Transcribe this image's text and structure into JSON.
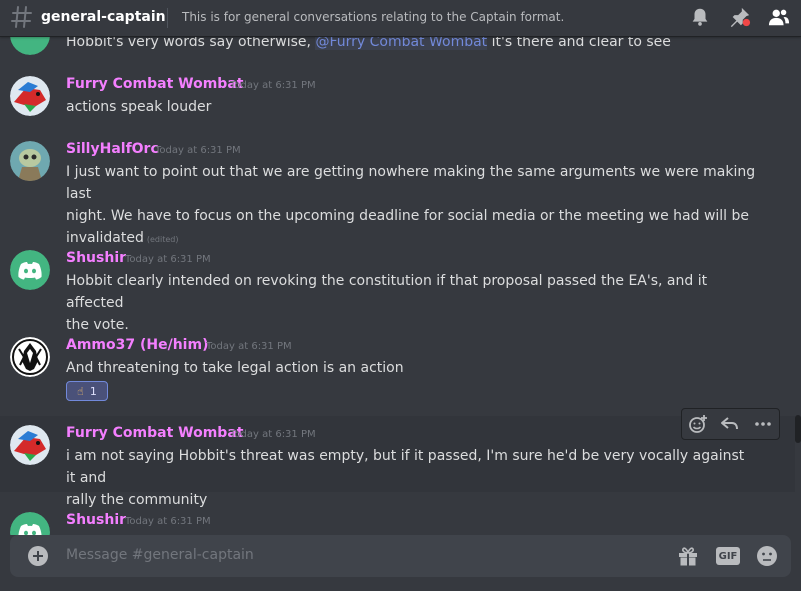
{
  "header": {
    "channel_name": "general-captain",
    "topic": "This is for general conversations relating to the Captain format."
  },
  "messages": [
    {
      "id": "m0",
      "text_before": "Hobbit's very words say otherwise, ",
      "mention": "@Furry Combat Wombat",
      "text_after": " it's there and clear to see"
    },
    {
      "id": "m1",
      "username": "Furry Combat Wombat",
      "timestamp": "Today at 6:31 PM",
      "avatar": "red-bird-avatar",
      "text": "actions speak louder"
    },
    {
      "id": "m2",
      "username": "SillyHalfOrc",
      "timestamp": "Today at 6:31 PM",
      "avatar": "zombie-avatar",
      "text_line1": "I just want to point out that we are getting nowhere making the same arguments we were making last",
      "text_line2": "night. We have to focus on the upcoming deadline for social media or the meeting we had will be",
      "text_line3": "invalidated",
      "edited": "(edited)"
    },
    {
      "id": "m3",
      "username": "Shushir",
      "timestamp": "Today at 6:31 PM",
      "avatar": "discord-default-avatar",
      "text_line1": "Hobbit clearly intended on revoking the constitution if that proposal passed the EA's, and it affected",
      "text_line2": "the vote."
    },
    {
      "id": "m4",
      "username": "Ammo37 (He/him)",
      "timestamp": "Today at 6:31 PM",
      "avatar": "black-white-emblem-avatar",
      "text": "And threatening to take legal action is an action",
      "reaction_emoji": "☝",
      "reaction_count": "1"
    },
    {
      "id": "m5",
      "username": "Furry Combat Wombat",
      "timestamp": "Today at 6:31 PM",
      "avatar": "red-bird-avatar",
      "text_line1": "i am not saying Hobbit's threat was empty, but if it passed, I'm sure he'd be very vocally against it and",
      "text_line2": "rally the community"
    },
    {
      "id": "m6",
      "username": "Shushir",
      "timestamp": "Today at 6:31 PM",
      "avatar": "discord-default-avatar"
    }
  ],
  "composer": {
    "placeholder": "Message #general-captain",
    "gif_label": "GIF"
  },
  "colors": {
    "background": "#36393f",
    "username": "#f47fff",
    "mention": "#7289da",
    "discord_blurple_green": "#43b581"
  }
}
